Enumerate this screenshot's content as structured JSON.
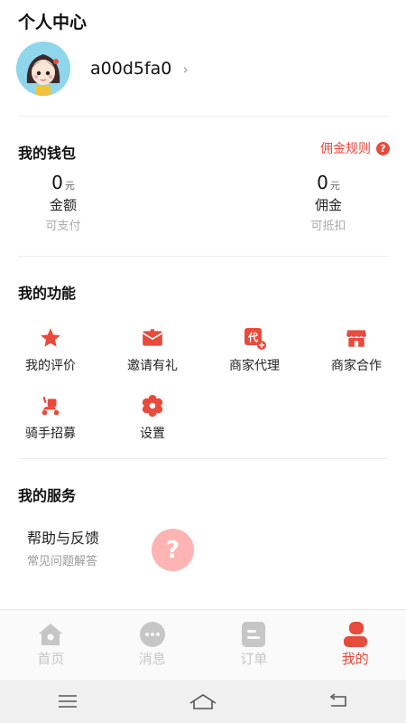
{
  "header": {
    "title": "个人中心"
  },
  "profile": {
    "username": "a00d5fa0",
    "avatar_icon": "avatar-girl-icon",
    "chevron": "›"
  },
  "wallet": {
    "title": "我的钱包",
    "rule_link": "佣金规则",
    "rule_icon": "?",
    "amount": {
      "value": "0",
      "unit": "元",
      "label": "金额",
      "sub": "可支付"
    },
    "commission": {
      "value": "0",
      "unit": "元",
      "label": "佣金",
      "sub": "可抵扣"
    }
  },
  "functions": {
    "title": "我的功能",
    "items": [
      {
        "label": "我的评价",
        "icon": "star-icon"
      },
      {
        "label": "邀请有礼",
        "icon": "envelope-icon"
      },
      {
        "label": "商家代理",
        "icon": "agent-icon",
        "icon_text": "代"
      },
      {
        "label": "商家合作",
        "icon": "shop-icon"
      },
      {
        "label": "骑手招募",
        "icon": "scooter-icon"
      },
      {
        "label": "设置",
        "icon": "settings-icon"
      }
    ]
  },
  "services": {
    "title": "我的服务",
    "help": {
      "title": "帮助与反馈",
      "sub": "常见问题解答",
      "icon_text": "?"
    }
  },
  "tabbar": {
    "items": [
      {
        "label": "首页",
        "icon": "home-icon",
        "active": false
      },
      {
        "label": "消息",
        "icon": "message-icon",
        "active": false
      },
      {
        "label": "订单",
        "icon": "order-icon",
        "active": false
      },
      {
        "label": "我的",
        "icon": "user-icon",
        "active": true
      }
    ]
  },
  "colors": {
    "accent": "#e84a3c",
    "inactive": "#c6c6c6",
    "help_bg": "#ffb4b4"
  }
}
